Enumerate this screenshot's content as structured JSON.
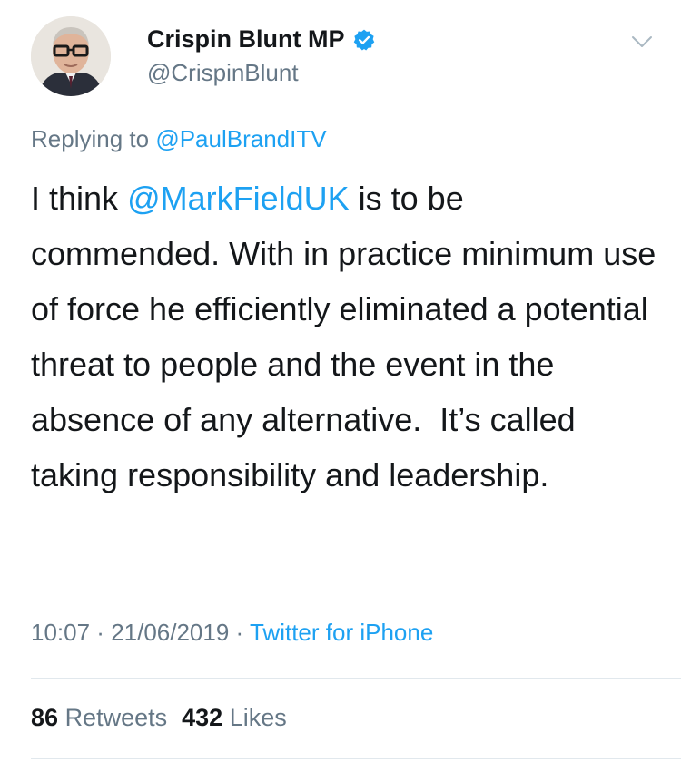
{
  "author": {
    "display_name": "Crispin Blunt MP",
    "handle": "@CrispinBlunt",
    "verified": true,
    "avatar_icon": "profile-photo"
  },
  "reply": {
    "prefix": "Replying to ",
    "mention": "@PaulBrandITV"
  },
  "tweet": {
    "text_before": "I think ",
    "mention": "@MarkFieldUK",
    "text_after": " is to be commended. With in practice minimum use of force he efficiently eliminated a potential threat to people and the event in the absence of any alternative.  It’s called taking responsibility and leadership."
  },
  "meta": {
    "time": "10:07",
    "separator": " · ",
    "date": "21/06/2019",
    "source": "Twitter for iPhone"
  },
  "stats": {
    "retweets_count": "86",
    "retweets_label": "Retweets",
    "likes_count": "432",
    "likes_label": "Likes"
  },
  "colors": {
    "link": "#1da1f2",
    "secondary_text": "#657786",
    "primary_text": "#14171a"
  }
}
